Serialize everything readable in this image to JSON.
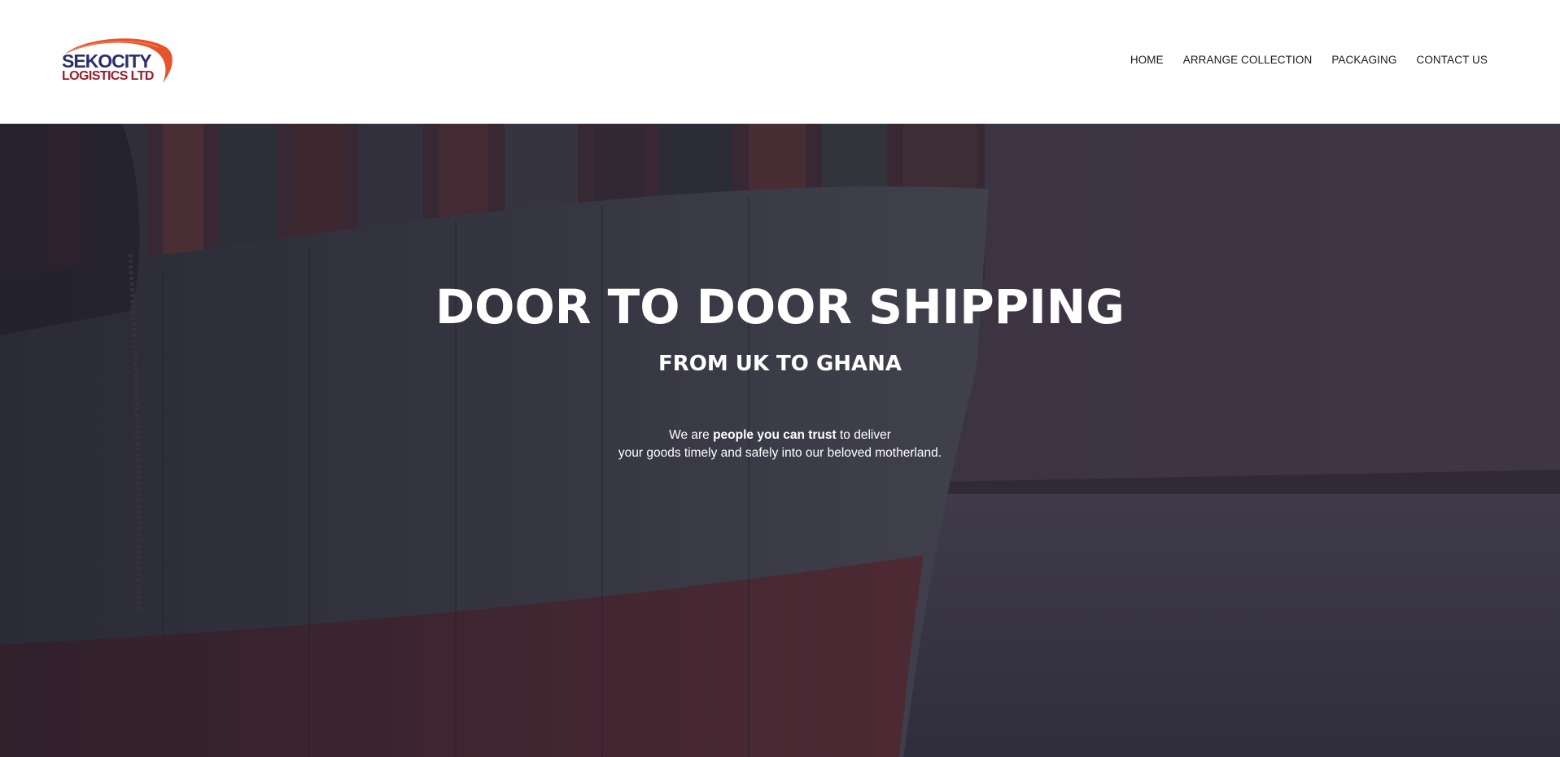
{
  "brand": {
    "logo_line1": "SEKOCITY",
    "logo_line2": "LOGISTICS LTD",
    "logo_colors": {
      "navy": "#2b2f6b",
      "red": "#9b1b2a",
      "orange": "#e8532c"
    }
  },
  "nav": {
    "items": [
      {
        "label": "HOME"
      },
      {
        "label": "ARRANGE COLLECTION"
      },
      {
        "label": "PACKAGING"
      },
      {
        "label": "CONTACT US"
      }
    ]
  },
  "hero": {
    "title": "DOOR TO DOOR SHIPPING",
    "subtitle": "FROM UK TO GHANA",
    "text_prefix": "We are ",
    "text_strong": "people you can trust",
    "text_suffix": " to deliver",
    "text_line2": "your goods timely and safely into our beloved motherland.",
    "background": "container-ship-hull"
  }
}
